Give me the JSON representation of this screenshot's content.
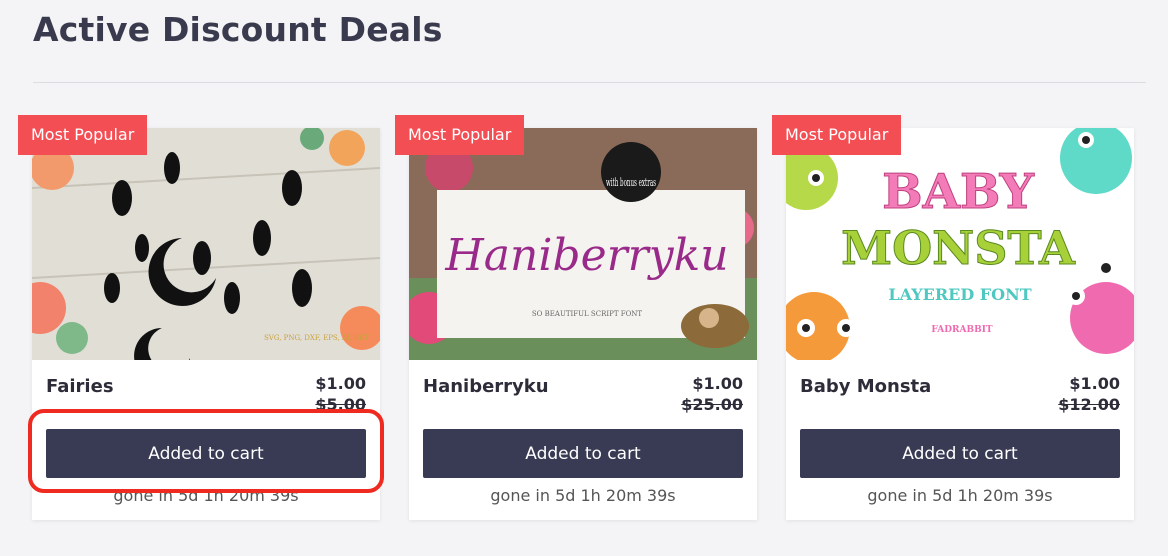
{
  "page": {
    "title": "Active Discount Deals"
  },
  "colors": {
    "badge": "#f24e54",
    "button": "#393a54",
    "highlight": "#ef2a20"
  },
  "deals": [
    {
      "badge": "Most Popular",
      "name": "Fairies",
      "price": "$1.00",
      "old_price": "$5.00",
      "button_label": "Added to cart",
      "timer": "gone in 5d 1h 20m 39s",
      "image_caption": "SVG, PNG, DXF, EPS, AI, SKT"
    },
    {
      "badge": "Most Popular",
      "name": "Haniberryku",
      "price": "$1.00",
      "old_price": "$25.00",
      "button_label": "Added to cart",
      "timer": "gone in 5d 1h 20m 39s",
      "image_title": "Haniberryku",
      "image_bonus": "with bonus extras",
      "image_subtitle": "SO BEAUTIFUL SCRIPT FONT"
    },
    {
      "badge": "Most Popular",
      "name": "Baby Monsta",
      "price": "$1.00",
      "old_price": "$12.00",
      "button_label": "Added to cart",
      "timer": "gone in 5d 1h 20m 39s",
      "image_line1": "BABY",
      "image_line2": "MONSTA",
      "image_line3": "LAYERED FONT",
      "image_brand": "FADRABBIT"
    }
  ]
}
